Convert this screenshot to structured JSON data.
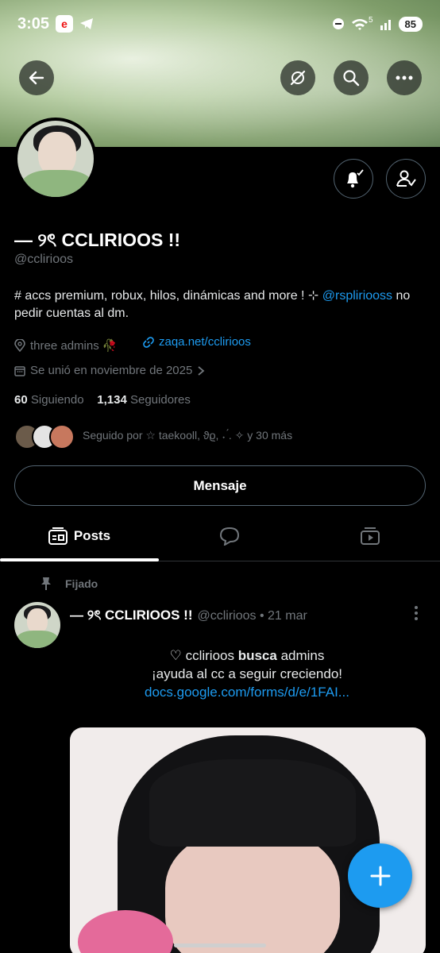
{
  "status_bar": {
    "time": "3:05",
    "signal_badge": "5",
    "battery": "85"
  },
  "profile": {
    "name": "— ୨ৎ CCLIRIOOS !!",
    "handle": "@cclirioos",
    "bio_prefix": "# accs premium, robux, hilos, dinámicas and more ! ⊹ ",
    "bio_mention": "@rspliriooss",
    "bio_suffix": " no pedir cuentas al dm.",
    "location": "three admins 🥀",
    "website": "zaqa.net/cclirioos",
    "joined": "Se unió en noviembre de 2025",
    "following_count": "60",
    "following_label": "Siguiendo",
    "followers_count": "1,134",
    "followers_label": "Seguidores",
    "followed_by": "Seguido por ☆ taekooll, ϑϱ, ˖ ́. ✧ y 30 más",
    "message_button": "Mensaje"
  },
  "tabs": [
    {
      "label": "Posts",
      "icon": "posts-icon"
    },
    {
      "label": "",
      "icon": "replies-icon"
    },
    {
      "label": "",
      "icon": "media-icon"
    }
  ],
  "pinned_post": {
    "pinned_label": "Fijado",
    "author_name": "— ୨ৎ CCLIRIOOS !!",
    "author_meta": "@cclirioos • 21 mar",
    "line1_prefix": "♡  cclirioos ",
    "line1_bold": "busca",
    "line1_suffix": " admins",
    "line2": "¡ayuda al cc a seguir creciendo!",
    "link": "docs.google.com/forms/d/e/1FAI..."
  },
  "colors": {
    "accent": "#1d9bf0",
    "background": "#000000",
    "muted": "#71767b"
  }
}
